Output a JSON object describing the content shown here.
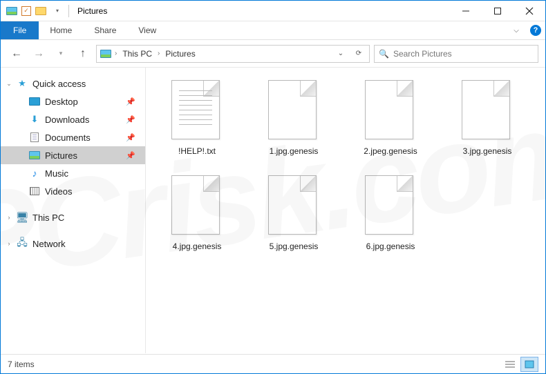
{
  "titlebar": {
    "app_title": "Pictures"
  },
  "ribbon": {
    "file": "File",
    "tabs": [
      "Home",
      "Share",
      "View"
    ]
  },
  "breadcrumbs": {
    "items": [
      "This PC",
      "Pictures"
    ]
  },
  "search": {
    "placeholder": "Search Pictures"
  },
  "tree": {
    "quick_access": "Quick access",
    "quick_items": [
      {
        "label": "Desktop",
        "icon": "desktop",
        "pinned": true
      },
      {
        "label": "Downloads",
        "icon": "downloads",
        "pinned": true
      },
      {
        "label": "Documents",
        "icon": "documents",
        "pinned": true
      },
      {
        "label": "Pictures",
        "icon": "pictures",
        "pinned": true,
        "selected": true
      },
      {
        "label": "Music",
        "icon": "music",
        "pinned": false
      },
      {
        "label": "Videos",
        "icon": "videos",
        "pinned": false
      }
    ],
    "this_pc": "This PC",
    "network": "Network"
  },
  "files": [
    {
      "name": "!HELP!.txt",
      "type": "txt"
    },
    {
      "name": "1.jpg.genesis",
      "type": "unknown"
    },
    {
      "name": "2.jpeg.genesis",
      "type": "unknown"
    },
    {
      "name": "3.jpg.genesis",
      "type": "unknown"
    },
    {
      "name": "4.jpg.genesis",
      "type": "unknown"
    },
    {
      "name": "5.jpg.genesis",
      "type": "unknown"
    },
    {
      "name": "6.jpg.genesis",
      "type": "unknown"
    }
  ],
  "status": {
    "count_text": "7 items"
  },
  "watermark": "PCrisk.com"
}
